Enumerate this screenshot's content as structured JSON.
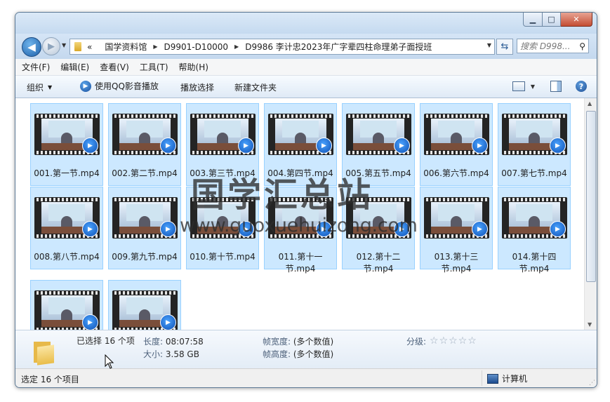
{
  "window": {
    "caption_buttons": {
      "minimize": "▁",
      "maximize": "□",
      "close": "✕"
    }
  },
  "nav": {
    "back_glyph": "◀",
    "forward_glyph": "▶",
    "breadcrumb_prefix": "«",
    "breadcrumbs": [
      "国学资料馆",
      "D9901-D10000",
      "D9986 李计忠2023年广字辈四柱命理弟子面授班"
    ],
    "search_placeholder": "搜索 D998..."
  },
  "menu": [
    "文件(F)",
    "编辑(E)",
    "查看(V)",
    "工具(T)",
    "帮助(H)"
  ],
  "toolbar": {
    "organize": "组织",
    "play_with": "使用QQ影音播放",
    "play_selection": "播放选择",
    "new_folder": "新建文件夹"
  },
  "files": [
    "001.第一节.mp4",
    "002.第二节.mp4",
    "003.第三节.mp4",
    "004.第四节.mp4",
    "005.第五节.mp4",
    "006.第六节.mp4",
    "007.第七节.mp4",
    "008.第八节.mp4",
    "009.第九节.mp4",
    "010.第十节.mp4",
    "011.第十一节.mp4",
    "012.第十二节.mp4",
    "013.第十三节.mp4",
    "014.第十四节.mp4",
    "",
    ""
  ],
  "details": {
    "selected": "已选择 16 个项",
    "length_label": "长度:",
    "length_value": "08:07:58",
    "size_label": "大小:",
    "size_value": "3.58 GB",
    "frame_width_label": "帧宽度:",
    "frame_width_value": "(多个数值)",
    "frame_height_label": "帧高度:",
    "frame_height_value": "(多个数值)",
    "rating_label": "分级:",
    "rating_stars": 0
  },
  "status": {
    "left": "选定 16 个项目",
    "right": "计算机"
  },
  "watermark": {
    "title": "国学汇总站",
    "url": "www.guoxuehuizong.com"
  }
}
